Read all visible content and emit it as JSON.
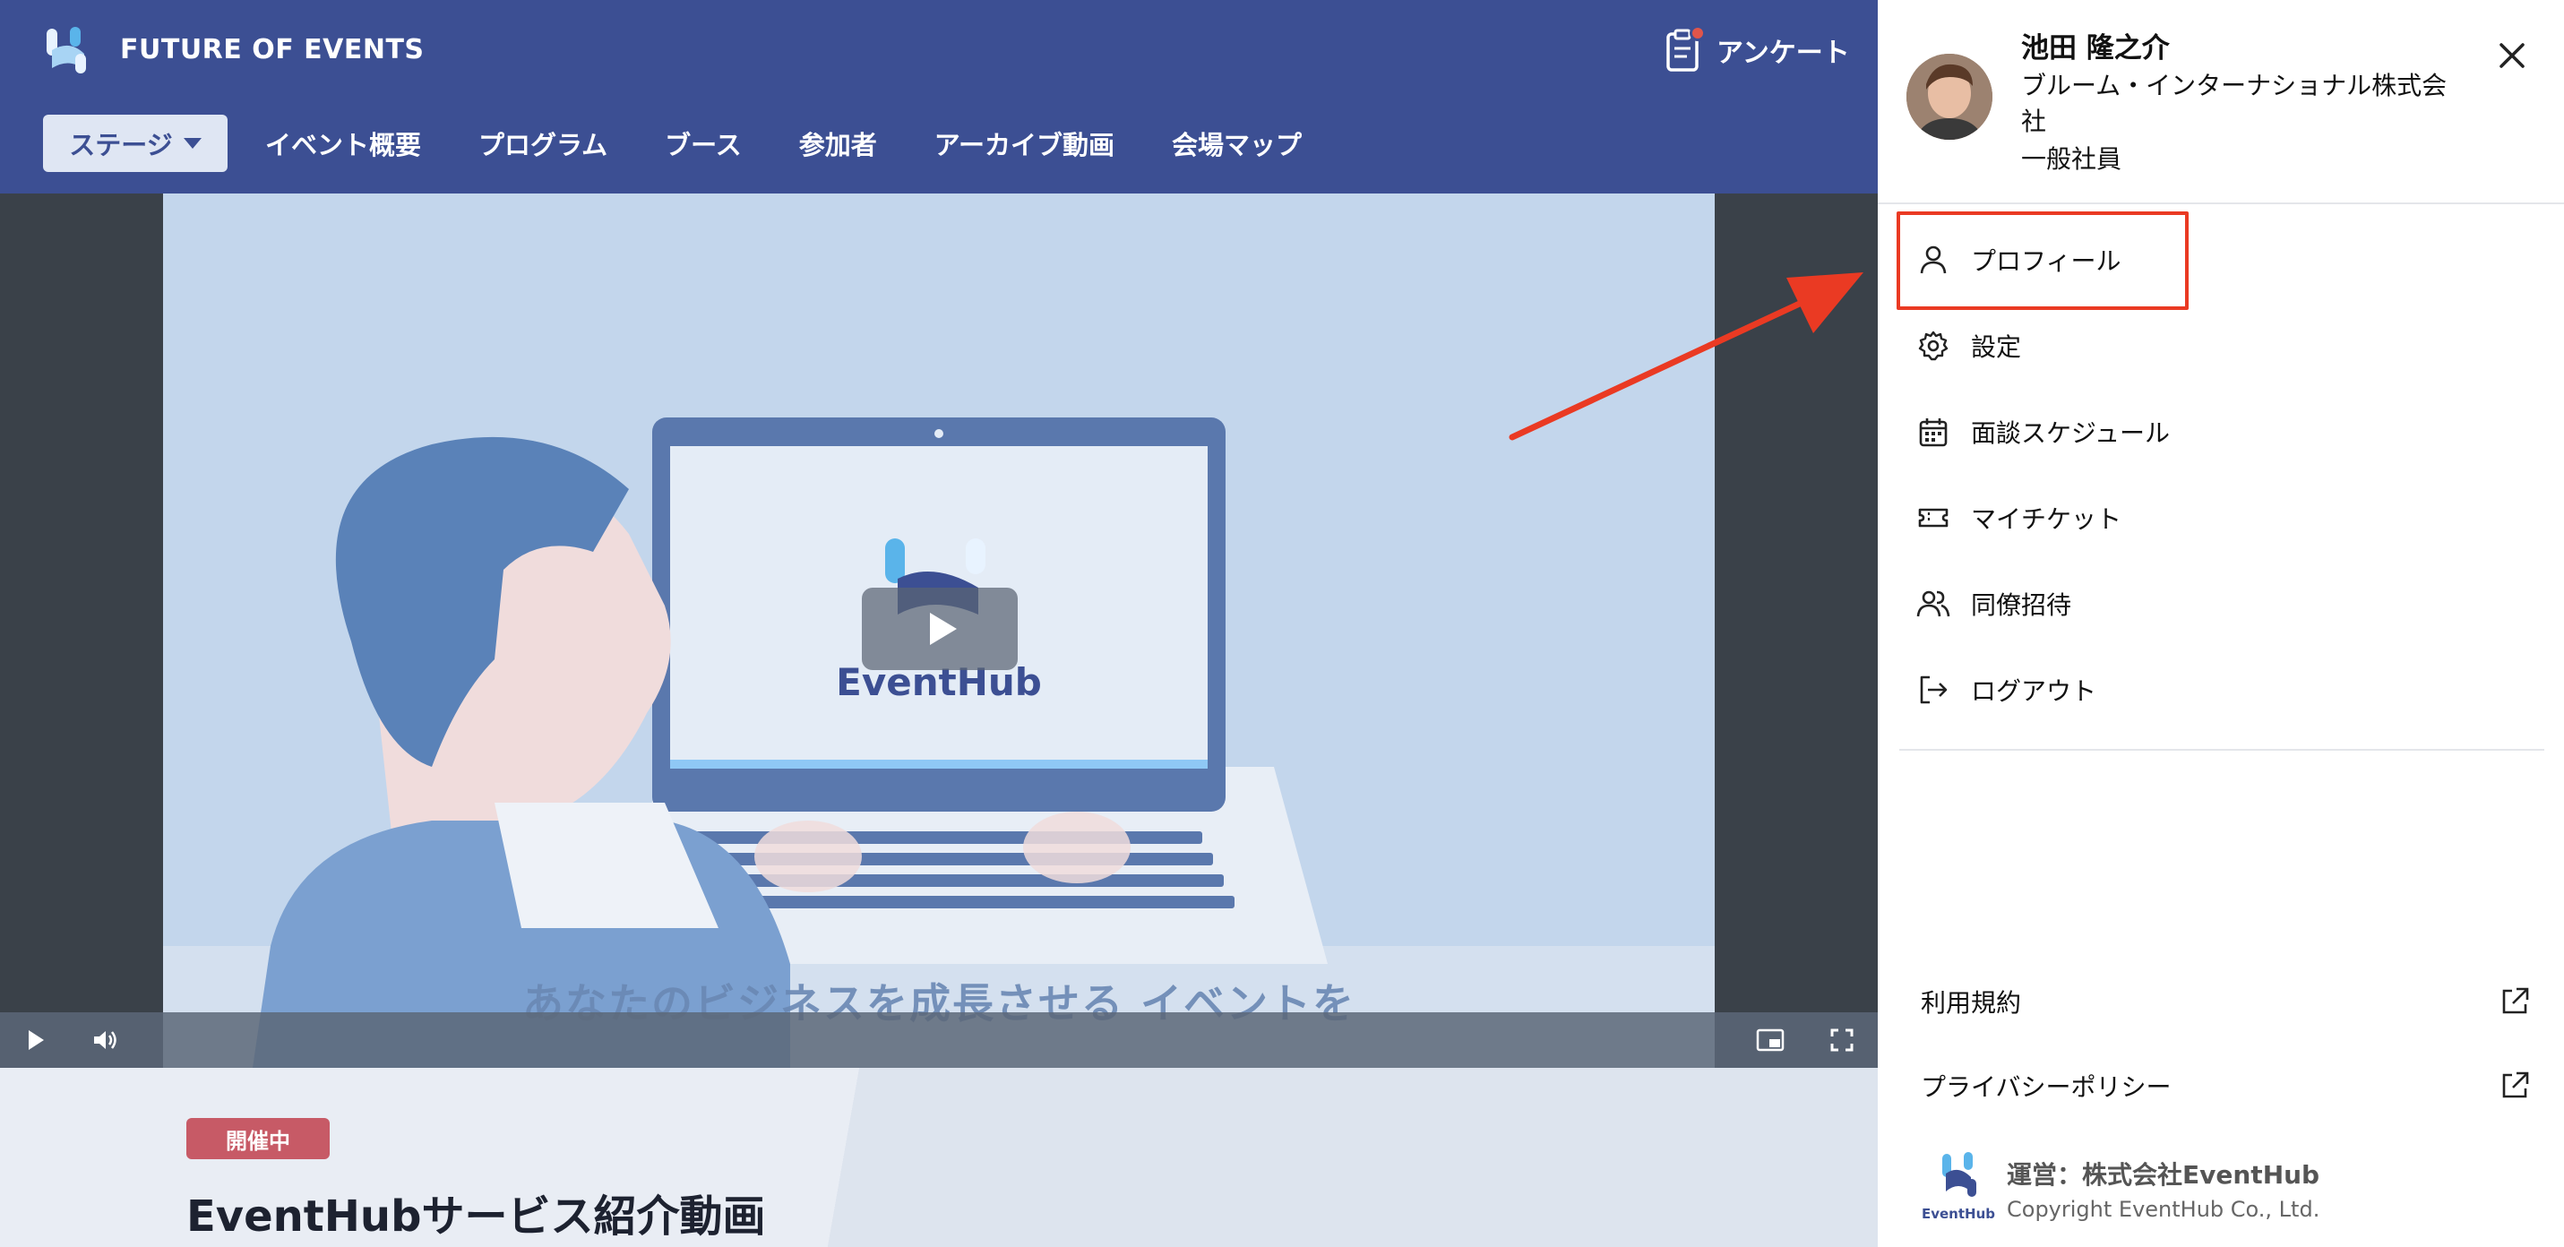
{
  "header": {
    "brand": "FUTURE OF EVENTS",
    "survey_label": "アンケート",
    "nav": {
      "stage": "ステージ",
      "items": [
        "イベント概要",
        "プログラム",
        "ブース",
        "参加者",
        "アーカイブ動画",
        "会場マップ"
      ]
    }
  },
  "video": {
    "logo_text": "EventHub",
    "caption": "あなたのビジネスを成長させる  イベントを"
  },
  "event": {
    "status_badge": "開催中",
    "title": "EventHubサービス紹介動画"
  },
  "user": {
    "name": "池田 隆之介",
    "company": "ブルーム・インターナショナル株式会社",
    "role": "一般社員"
  },
  "menu": [
    {
      "label": "プロフィール",
      "icon": "person-icon"
    },
    {
      "label": "設定",
      "icon": "gear-icon"
    },
    {
      "label": "面談スケジュール",
      "icon": "calendar-icon"
    },
    {
      "label": "マイチケット",
      "icon": "ticket-icon"
    },
    {
      "label": "同僚招待",
      "icon": "people-icon"
    },
    {
      "label": "ログアウト",
      "icon": "logout-icon"
    }
  ],
  "links": [
    {
      "label": "利用規約",
      "icon": "external-link-icon"
    },
    {
      "label": "プライバシーポリシー",
      "icon": "external-link-icon"
    }
  ],
  "footer": {
    "logo_text": "EventHub",
    "operator": "運営：株式会社EventHub",
    "copyright": "Copyright EventHub Co., Ltd."
  },
  "colors": {
    "header_bg": "#3c4f93",
    "highlight": "#ea3a23",
    "badge": "#c75a66"
  }
}
